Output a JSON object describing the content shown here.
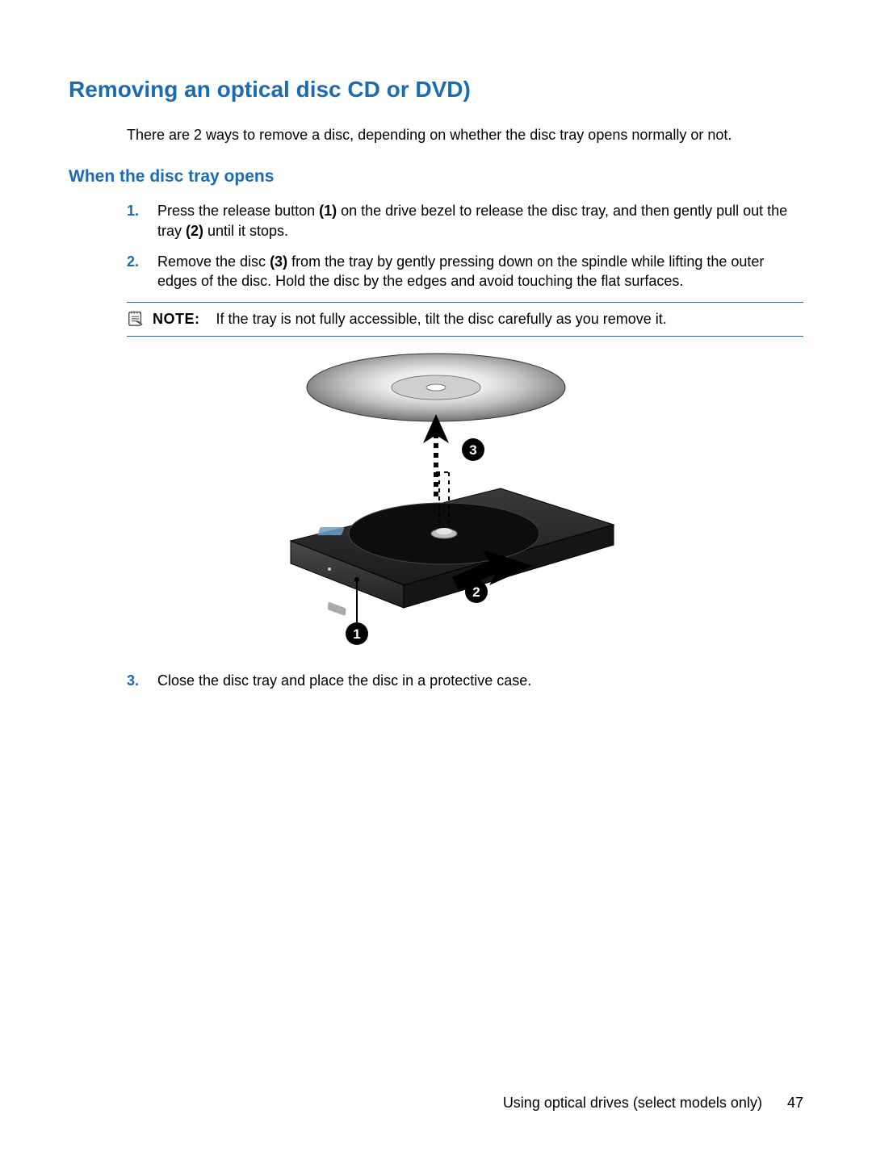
{
  "heading": "Removing an optical disc CD or DVD)",
  "intro": "There are 2 ways to remove a disc, depending on whether the disc tray opens normally or not.",
  "subheading": "When the disc tray opens",
  "steps": {
    "s1": {
      "num": "1.",
      "a": "Press the release button ",
      "b1": "(1)",
      "c": " on the drive bezel to release the disc tray, and then gently pull out the tray ",
      "b2": "(2)",
      "d": " until it stops."
    },
    "s2": {
      "num": "2.",
      "a": "Remove the disc ",
      "b1": "(3)",
      "c": " from the tray by gently pressing down on the spindle while lifting the outer edges of the disc. Hold the disc by the edges and avoid touching the flat surfaces."
    },
    "s3": {
      "num": "3.",
      "a": "Close the disc tray and place the disc in a protective case."
    }
  },
  "note": {
    "label": "NOTE:",
    "text": "If the tray is not fully accessible, tilt the disc carefully as you remove it."
  },
  "callouts": {
    "c1": "1",
    "c2": "2",
    "c3": "3"
  },
  "footer": {
    "section": "Using optical drives (select models only)",
    "page": "47"
  }
}
